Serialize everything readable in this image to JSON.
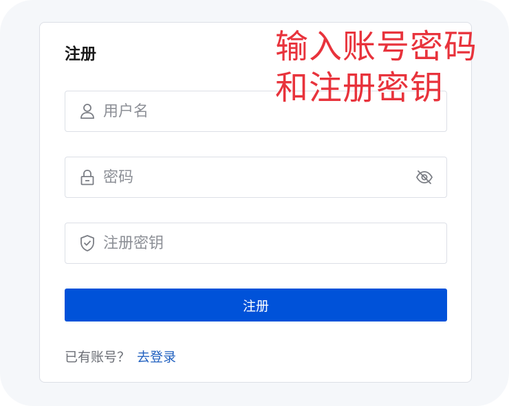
{
  "form": {
    "title": "注册",
    "username": {
      "placeholder": "用户名",
      "value": ""
    },
    "password": {
      "placeholder": "密码",
      "value": ""
    },
    "register_key": {
      "placeholder": "注册密钥",
      "value": ""
    },
    "submit_label": "注册",
    "footer_text": "已有账号？",
    "login_link": "去登录"
  },
  "annotation": {
    "line1": "输入账号密码",
    "line2": "和注册密钥"
  },
  "colors": {
    "primary": "#0052d9",
    "link": "#1f5fbf",
    "annotation": "#e8333c"
  },
  "icons": {
    "username": "user-icon",
    "password": "lock-icon",
    "password_toggle": "eye-off-icon",
    "register_key": "shield-check-icon"
  }
}
